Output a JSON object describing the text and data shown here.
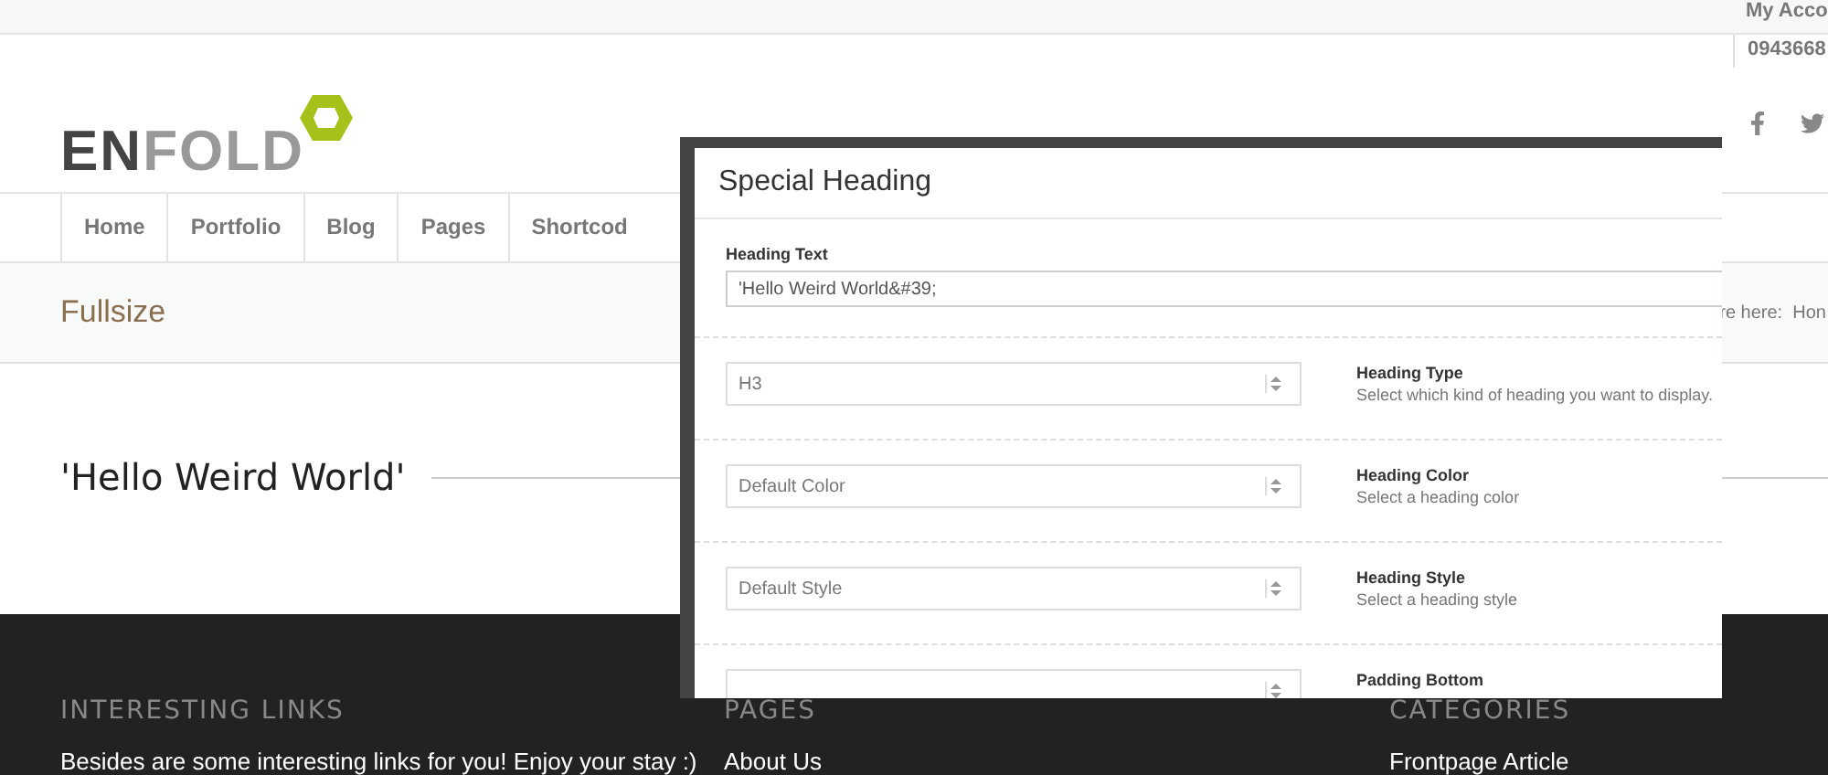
{
  "top_bar": {
    "account": "My Acco",
    "phone": "0943668"
  },
  "logo": {
    "dark": "EN",
    "light": "FOLD"
  },
  "nav": [
    {
      "label": "Home"
    },
    {
      "label": "Portfolio"
    },
    {
      "label": "Blog"
    },
    {
      "label": "Pages"
    },
    {
      "label": "Shortcod"
    }
  ],
  "title_bar": {
    "title": "Fullsize",
    "breadcrumb": "re here:  Hon"
  },
  "content": {
    "heading": "'Hello Weird World'"
  },
  "footer": [
    {
      "heading": "INTERESTING LINKS",
      "text": "Besides are some interesting links for you! Enjoy your stay :)"
    },
    {
      "heading": "PAGES",
      "text": "About Us"
    },
    {
      "heading": "CATEGORIES",
      "text": "Frontpage Article"
    }
  ],
  "dialog": {
    "title": "Special Heading",
    "text_label": "Heading Text",
    "text_value": "'Hello Weird World&#39;",
    "rows": [
      {
        "value": "H3",
        "label": "Heading Type",
        "hint": "Select which kind of heading you want to display."
      },
      {
        "value": "Default Color",
        "label": "Heading Color",
        "hint": "Select a heading color"
      },
      {
        "value": "Default Style",
        "label": "Heading Style",
        "hint": "Select a heading style"
      },
      {
        "label": "Padding Bottom"
      }
    ]
  }
}
